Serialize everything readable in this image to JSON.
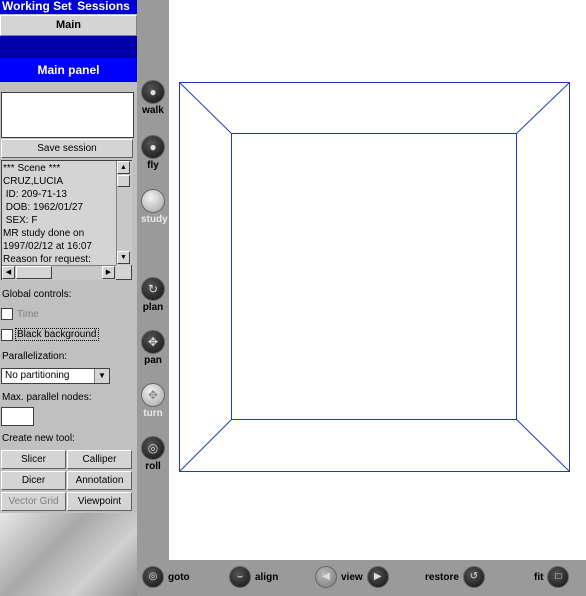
{
  "menu": {
    "working_set": "Working Set",
    "sessions": "Sessions"
  },
  "tab_main": "Main",
  "main_panel_title": "Main panel",
  "save_session": "Save session",
  "scene_lines": [
    "*** Scene ***",
    "CRUZ,LUCIA",
    " ID: 209-71-13",
    " DOB: 1962/01/27",
    " SEX: F",
    "MR study done on",
    "1997/02/12 at 16:07",
    "Reason for request:"
  ],
  "global_controls": "Global controls:",
  "time_label": "Time",
  "black_background_label": "Black background",
  "parallelization_label": "Parallelization:",
  "partition_value": "No partitioning",
  "max_nodes_label": "Max. parallel nodes:",
  "create_tool_label": "Create new tool:",
  "tools": {
    "slicer": "Slicer",
    "calliper": "Calliper",
    "dicer": "Dicer",
    "annotation": "Annotation",
    "vector_grid": "Vector Grid",
    "viewpoint": "Viewpoint"
  },
  "side_buttons": {
    "walk": "walk",
    "fly": "fly",
    "study": "study",
    "plan": "plan",
    "pan": "pan",
    "turn": "turn",
    "roll": "roll"
  },
  "bottom_buttons": {
    "goto": "goto",
    "align": "align",
    "view": "view",
    "restore": "restore",
    "fit": "fit"
  },
  "colors": {
    "menu_blue": "#0000d0",
    "panel_blue": "#0000ff",
    "wire_blue": "#1c3cc0"
  }
}
